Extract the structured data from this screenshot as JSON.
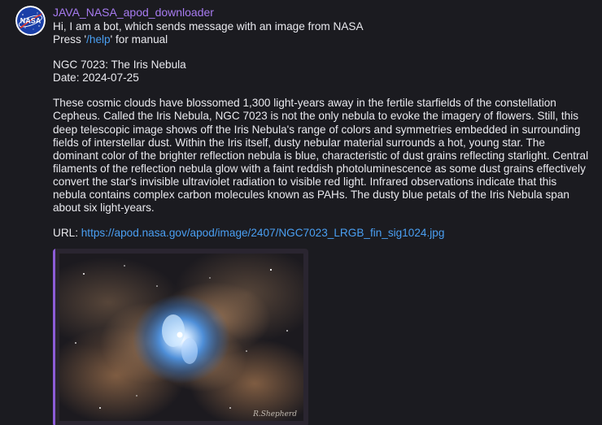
{
  "bot": {
    "name": "JAVA_NASA_apod_downloader",
    "avatar_text": "NASA"
  },
  "message": {
    "intro_line1": "Hi, I am a bot, which sends message with an image from NASA",
    "intro_press": "Press '",
    "help_command": "/help",
    "intro_press_suffix": "' for manual",
    "title_line": "NGC 7023: The Iris Nebula",
    "date_line": "Date: 2024-07-25",
    "body": "These cosmic clouds have blossomed 1,300 light-years away in the fertile starfields of the constellation Cepheus. Called the Iris Nebula, NGC 7023 is not the only nebula to evoke the imagery of flowers. Still, this deep telescopic image shows off the Iris Nebula's range of colors and symmetries embedded in surrounding fields of interstellar dust. Within the Iris itself, dusty nebular material surrounds a hot, young star. The dominant color of the brighter reflection nebula is blue, characteristic of dust grains reflecting starlight. Central filaments of the reflection nebula glow with a faint reddish photoluminescence as some dust grains effectively convert the star's invisible ultraviolet radiation to visible red light. Infrared observations indicate that this nebula contains complex carbon molecules known as PAHs. The dusty blue petals of the Iris Nebula span about six light-years.",
    "url_label": "URL: ",
    "url": "https://apod.nasa.gov/apod/image/2407/NGC7023_LRGB_fin_sig1024.jpg"
  },
  "preview": {
    "signature": "R.Shepherd"
  },
  "colors": {
    "background": "#1b1b20",
    "sender": "#a77bf0",
    "link": "#4a9ff2",
    "preview_bar": "#8c5cd8"
  }
}
